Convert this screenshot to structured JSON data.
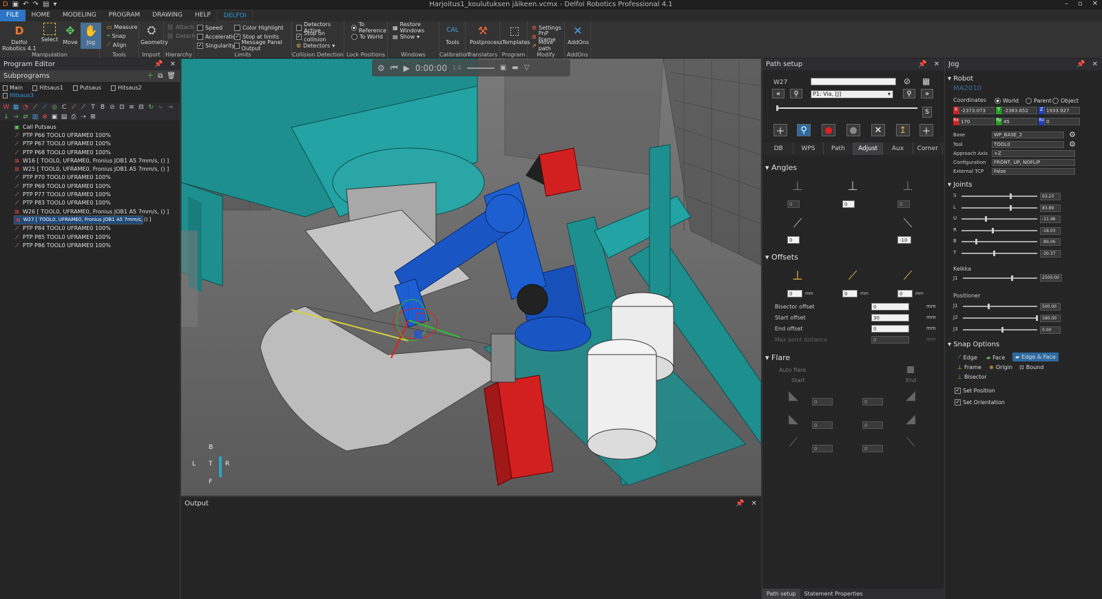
{
  "window": {
    "title": "Harjoitus1_koulutuksen jälkeen.vcmx - Delfoi Robotics Professional 4.1"
  },
  "menu": [
    "FILE",
    "HOME",
    "MODELING",
    "PROGRAM",
    "DRAWING",
    "HELP",
    "DELFOI"
  ],
  "ribbon": {
    "delfoi_label": "Delfoi Robotics 4.1",
    "select": "Select",
    "move": "Move",
    "jog": "Jog",
    "manipulation": "Manipulation",
    "measure": "Measure",
    "snap": "Snap",
    "align": "Align",
    "tools_group": "Tools",
    "geometry": "Geometry",
    "import": "Import",
    "attach": "Attach",
    "detach": "Detach",
    "hierarchy": "Hierarchy",
    "speed": "Speed",
    "acceleration": "Acceleration",
    "singularity": "Singularity",
    "color_highlight": "Color Highlight",
    "stop_at_limits": "Stop at limits",
    "message_panel_output": "Message Panel Output",
    "limits": "Limits",
    "detectors_active": "Detectors Active",
    "stop_on_collision": "Stop on collision",
    "detectors": "Detectors",
    "collision_detection": "Collision Detection",
    "to_reference": "To Reference",
    "to_world": "To World",
    "lock_positions": "Lock Positions",
    "restore_windows": "Restore Windows",
    "show": "Show",
    "windows": "Windows",
    "tools": "Tools",
    "calibration": "Calibration",
    "postprocess": "Postprocess",
    "translators": "Translators",
    "templates": "Templates",
    "program": "Program",
    "settings": "Settings",
    "pnp_frame": "PnP Frame",
    "move_path": "Move path",
    "modify": "Modify",
    "addons": "AddOns"
  },
  "program_editor": {
    "title": "Program Editor",
    "subprograms": "Subprograms",
    "subs": [
      "Main",
      "Hitsaus1",
      "Putsaus",
      "Hitsaus2",
      "Hitsaus3"
    ],
    "rows": [
      "Call Putsaus",
      "PTP P66 TOOL0 UFRAME0 100%",
      "PTP P67 TOOL0 UFRAME0 100%",
      "PTP P68 TOOL0 UFRAME0 100%",
      "W16 [ TOOL0, UFRAME0, Fronius JOB1 A5 7mm/s, () ]",
      "W25 [ TOOL0, UFRAME0, Fronius JOB1 A5 7mm/s, () ]",
      "PTP P70 TOOL0 UFRAME0 100%",
      "PTP P69 TOOL0 UFRAME0 100%",
      "PTP P77 TOOL0 UFRAME0 100%",
      "PTP P83 TOOL0 UFRAME0 100%",
      "W26 [ TOOL0, UFRAME0, Fronius JOB1 A5 7mm/s, () ]",
      "W27 [ TOOL0, UFRAME0, Fronius JOB1 A5 7mm/s, () ]",
      "PTP P78 TOOL0 UFRAME0 100%",
      "PTP P84 TOOL0 UFRAME0 100%",
      "PTP P85 TOOL0 UFRAME0 100%",
      "PTP P86 TOOL0 UFRAME0 100%"
    ]
  },
  "playback": {
    "time": "0:00:00",
    "speed": "1.0"
  },
  "viewcube": {
    "b": "B",
    "l": "L",
    "t": "T",
    "r": "R",
    "f": "F"
  },
  "output": {
    "title": "Output"
  },
  "path_setup": {
    "title": "Path setup",
    "name": "W27",
    "via": "P1: Via, [J]",
    "s": "S",
    "tabs": [
      "DB",
      "WPS",
      "Path",
      "Adjust",
      "Aux",
      "Corner"
    ],
    "angles": "Angles",
    "angle_vals": [
      "0",
      "0",
      "0",
      "0",
      "-10"
    ],
    "offsets": "Offsets",
    "offset_vals": [
      "0",
      "0",
      "0"
    ],
    "mm": "mm",
    "bisector_offset": "Bisector offset",
    "bisector_val": "0",
    "start_offset": "Start offset",
    "start_val": "30",
    "end_offset": "End offset",
    "end_val": "0",
    "max_point_distance": "Max point distance",
    "max_val": "0",
    "flare": "Flare",
    "auto_flare": "Auto flare",
    "start": "Start",
    "end": "End",
    "flare_vals": [
      "0",
      "0",
      "0",
      "0",
      "0",
      "0"
    ],
    "bottom_tabs": [
      "Path setup",
      "Statement Properties"
    ]
  },
  "jog": {
    "title": "Jog",
    "robot": "Robot",
    "robot_name": "MA2010",
    "coordinates": "Coordinates",
    "world": "World",
    "parent": "Parent",
    "object": "Object",
    "x": "-2373.073",
    "y": "-2383.652",
    "z": "1933.927",
    "rx": "170",
    "ry": "45",
    "rz": "0",
    "base": "Base",
    "base_val": "WP_BASE_2",
    "tool": "Tool",
    "tool_val": "TOOL0",
    "approach": "Approach Axis",
    "approach_val": "+Z",
    "configuration": "Configuration",
    "config_val": "FRONT, UP, NOFLIP",
    "external_tcp": "External TCP",
    "ext_val": "False",
    "joints": "Joints",
    "joint_list": [
      {
        "n": "S",
        "v": "63.23"
      },
      {
        "n": "L",
        "v": "83.89"
      },
      {
        "n": "U",
        "v": "-11.46"
      },
      {
        "n": "R",
        "v": "-18.03"
      },
      {
        "n": "B",
        "v": "-89.06"
      },
      {
        "n": "T",
        "v": "-30.37"
      }
    ],
    "kelkka": "Kelkka",
    "j1": "J1",
    "kelkka_val": "2500.00",
    "positioner": "Positioner",
    "pos_list": [
      {
        "n": "J1",
        "v": "500.00"
      },
      {
        "n": "J2",
        "v": "180.00"
      },
      {
        "n": "J3",
        "v": "0.00"
      }
    ],
    "snap_options": "Snap Options",
    "edge": "Edge",
    "face": "Face",
    "edge_face": "Edge & Face",
    "frame": "Frame",
    "origin": "Origin",
    "bound": "Bound",
    "bisector": "Bisector",
    "set_position": "Set Position",
    "set_orientation": "Set Orientation"
  }
}
